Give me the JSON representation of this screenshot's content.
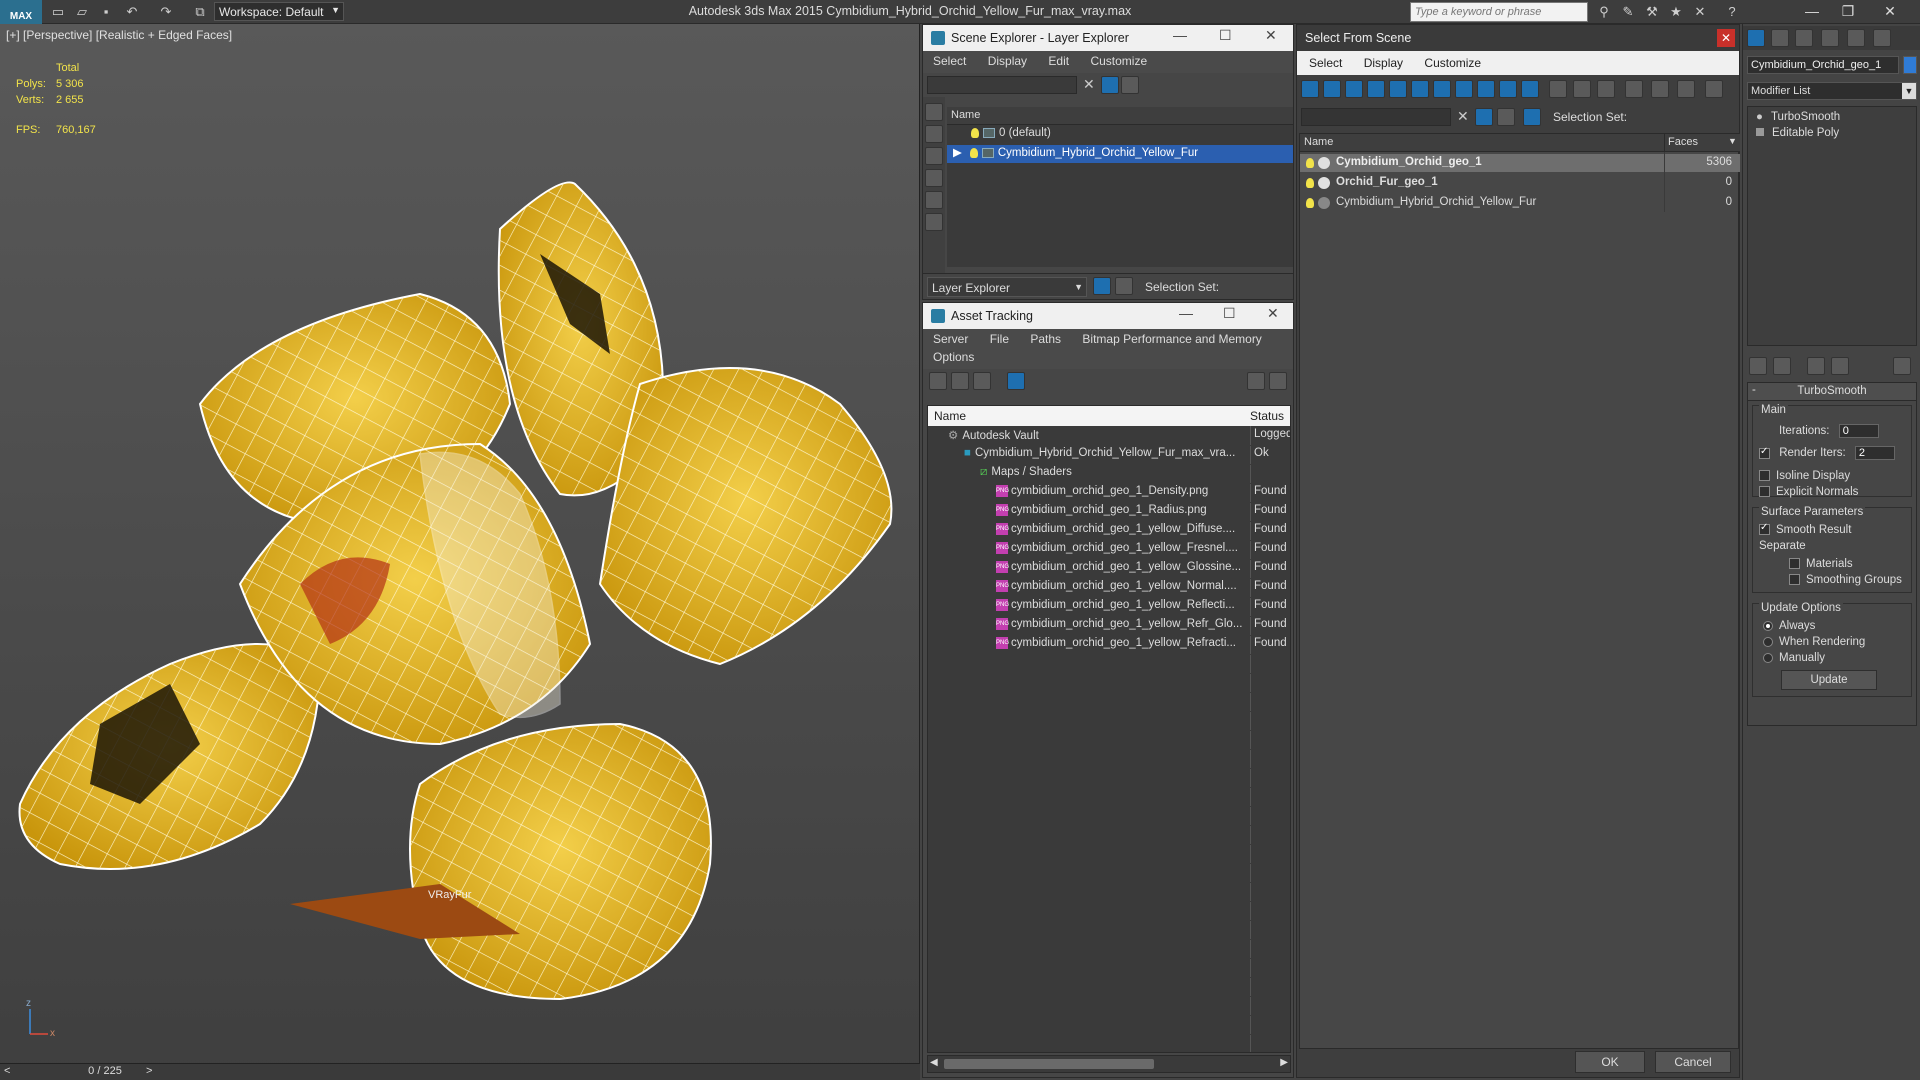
{
  "app": {
    "title": "Autodesk 3ds Max  2015    Cymbidium_Hybrid_Orchid_Yellow_Fur_max_vray.max",
    "logo": "MAX",
    "workspace": "Workspace: Default",
    "search_placeholder": "Type a keyword or phrase"
  },
  "viewport": {
    "label": "[+] [Perspective] [Realistic + Edged Faces]",
    "stats": {
      "total_label": "Total",
      "polys_label": "Polys:",
      "polys_value": "5 306",
      "verts_label": "Verts:",
      "verts_value": "2 655",
      "fps_label": "FPS:",
      "fps_value": "760,167"
    },
    "helper_label": "VRayFur",
    "axis_z": "z",
    "axis_x": "x"
  },
  "timeline": {
    "frame": "0 / 225",
    "prev": "<",
    "next": ">"
  },
  "scene_explorer": {
    "title": "Scene Explorer - Layer Explorer",
    "menus": [
      "Select",
      "Display",
      "Edit",
      "Customize"
    ],
    "column": "Name",
    "rows": [
      "0 (default)",
      "Cymbidium_Hybrid_Orchid_Yellow_Fur"
    ],
    "footer_mode": "Layer Explorer",
    "selection_set": "Selection Set:"
  },
  "asset_tracking": {
    "title": "Asset Tracking",
    "menus": [
      "Server",
      "File",
      "Paths",
      "Bitmap Performance and Memory"
    ],
    "menus2": [
      "Options"
    ],
    "col_name": "Name",
    "col_status": "Status",
    "rows": [
      {
        "name": "Autodesk Vault",
        "status": "Logged",
        "indent": 0,
        "kind": "vault"
      },
      {
        "name": "Cymbidium_Hybrid_Orchid_Yellow_Fur_max_vra...",
        "status": "Ok",
        "indent": 1,
        "kind": "max"
      },
      {
        "name": "Maps / Shaders",
        "status": "",
        "indent": 2,
        "kind": "maps"
      },
      {
        "name": "cymbidium_orchid_geo_1_Density.png",
        "status": "Found",
        "indent": 3,
        "kind": "png"
      },
      {
        "name": "cymbidium_orchid_geo_1_Radius.png",
        "status": "Found",
        "indent": 3,
        "kind": "png"
      },
      {
        "name": "cymbidium_orchid_geo_1_yellow_Diffuse....",
        "status": "Found",
        "indent": 3,
        "kind": "png"
      },
      {
        "name": "cymbidium_orchid_geo_1_yellow_Fresnel....",
        "status": "Found",
        "indent": 3,
        "kind": "png"
      },
      {
        "name": "cymbidium_orchid_geo_1_yellow_Glossine...",
        "status": "Found",
        "indent": 3,
        "kind": "png"
      },
      {
        "name": "cymbidium_orchid_geo_1_yellow_Normal....",
        "status": "Found",
        "indent": 3,
        "kind": "png"
      },
      {
        "name": "cymbidium_orchid_geo_1_yellow_Reflecti...",
        "status": "Found",
        "indent": 3,
        "kind": "png"
      },
      {
        "name": "cymbidium_orchid_geo_1_yellow_Refr_Glo...",
        "status": "Found",
        "indent": 3,
        "kind": "png"
      },
      {
        "name": "cymbidium_orchid_geo_1_yellow_Refracti...",
        "status": "Found",
        "indent": 3,
        "kind": "png"
      }
    ]
  },
  "select_from_scene": {
    "title": "Select From Scene",
    "menus": [
      "Select",
      "Display",
      "Customize"
    ],
    "selection_set": "Selection Set:",
    "col_name": "Name",
    "col_faces": "Faces",
    "rows": [
      {
        "name": "Cymbidium_Orchid_geo_1",
        "faces": "5306",
        "bold": true,
        "selected": true
      },
      {
        "name": "Orchid_Fur_geo_1",
        "faces": "0",
        "bold": true,
        "selected": false
      },
      {
        "name": "Cymbidium_Hybrid_Orchid_Yellow_Fur",
        "faces": "0",
        "bold": false,
        "selected": false
      }
    ],
    "ok": "OK",
    "cancel": "Cancel"
  },
  "command_panel": {
    "object_name": "Cymbidium_Orchid_geo_1",
    "modifier_list": "Modifier List",
    "stack": [
      "TurboSmooth",
      "Editable Poly"
    ],
    "rollout_title": "TurboSmooth",
    "main_label": "Main",
    "iterations_label": "Iterations:",
    "iterations_value": "0",
    "render_iters_label": "Render Iters:",
    "render_iters_value": "2",
    "isoline": "Isoline Display",
    "explicit_normals": "Explicit Normals",
    "surface_params": "Surface Parameters",
    "smooth_result": "Smooth Result",
    "separate": "Separate",
    "materials": "Materials",
    "smoothing_groups": "Smoothing Groups",
    "update_options": "Update Options",
    "always": "Always",
    "when_rendering": "When Rendering",
    "manually": "Manually",
    "update_button": "Update"
  },
  "colors": {
    "selection": "#2b5fb0",
    "accent": "#2a7da3",
    "petal": "#e8b81c",
    "stat_yellow": "#f2e34a"
  }
}
